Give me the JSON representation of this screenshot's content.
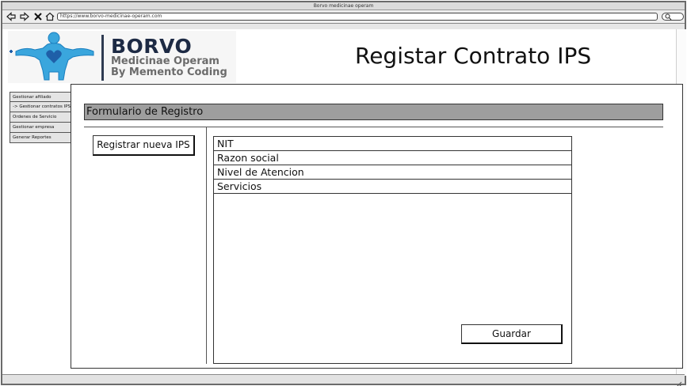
{
  "browser": {
    "title": "Borvo medicinae operam",
    "url": "https://www.borvo-medicinae-operam.com",
    "nav_icons": [
      "back-arrow-icon",
      "forward-arrow-icon",
      "close-icon",
      "home-icon"
    ],
    "search_icon": "search-icon"
  },
  "logo": {
    "brand": "BORVO",
    "subtitle": "Medicinae Operam",
    "tagline": "By Memento Coding",
    "colors": {
      "figure": "#3aa6dd",
      "heart": "#1f5fa8",
      "text_dark": "#1d2a44",
      "text_gray": "#6b6b6b"
    }
  },
  "page": {
    "title": "Registar Contrato IPS"
  },
  "sidebar": {
    "items": [
      {
        "label": "Gestionar afiliado"
      },
      {
        "label": "-> Gestionar contratos IPS"
      },
      {
        "label": "Ordenes de Servicio"
      },
      {
        "label": "Gestionar empresa"
      },
      {
        "label": "Generar Reportes"
      }
    ]
  },
  "form": {
    "header": "Formulario de Registro",
    "register_button": "Registrar nueva IPS",
    "fields": [
      {
        "label": "NIT"
      },
      {
        "label": "Razon social"
      },
      {
        "label": "Nivel de Atencion"
      },
      {
        "label": "Servicios"
      }
    ],
    "save_button": "Guardar"
  }
}
